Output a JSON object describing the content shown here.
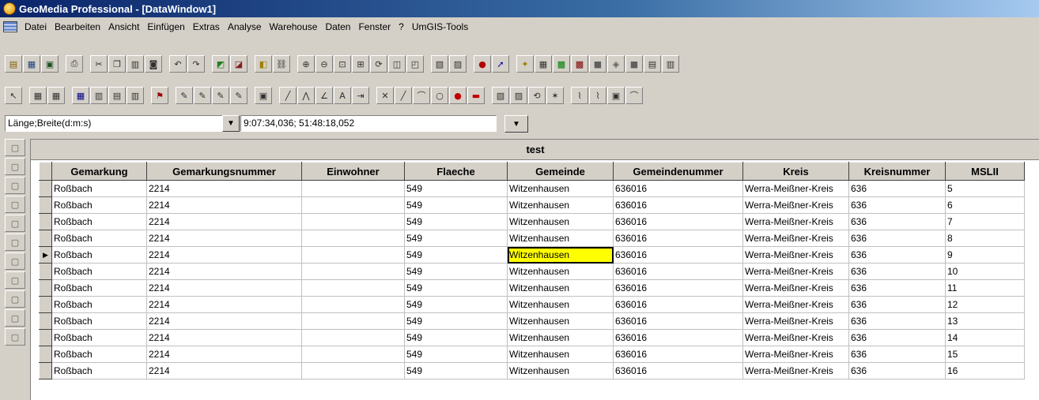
{
  "window": {
    "title": "GeoMedia Professional - [DataWindow1]"
  },
  "menu": [
    "Datei",
    "Bearbeiten",
    "Ansicht",
    "Einfügen",
    "Extras",
    "Analyse",
    "Warehouse",
    "Daten",
    "Fenster",
    "?",
    "UmGIS-Tools"
  ],
  "coords": {
    "system": "Länge;Breite(d:m:s)",
    "value": "9:07:34,036; 51:48:18,052"
  },
  "grid": {
    "caption": "test",
    "columns": [
      "Gemarkung",
      "Gemarkungsnummer",
      "Einwohner",
      "Flaeche",
      "Gemeinde",
      "Gemeindenummer",
      "Kreis",
      "Kreisnummer",
      "MSLII"
    ],
    "rows": [
      [
        "Roßbach",
        "2214",
        "",
        "549",
        "Witzenhausen",
        "636016",
        "Werra-Meißner-Kreis",
        "636",
        "5"
      ],
      [
        "Roßbach",
        "2214",
        "",
        "549",
        "Witzenhausen",
        "636016",
        "Werra-Meißner-Kreis",
        "636",
        "6"
      ],
      [
        "Roßbach",
        "2214",
        "",
        "549",
        "Witzenhausen",
        "636016",
        "Werra-Meißner-Kreis",
        "636",
        "7"
      ],
      [
        "Roßbach",
        "2214",
        "",
        "549",
        "Witzenhausen",
        "636016",
        "Werra-Meißner-Kreis",
        "636",
        "8"
      ],
      [
        "Roßbach",
        "2214",
        "",
        "549",
        "Witzenhausen",
        "636016",
        "Werra-Meißner-Kreis",
        "636",
        "9"
      ],
      [
        "Roßbach",
        "2214",
        "",
        "549",
        "Witzenhausen",
        "636016",
        "Werra-Meißner-Kreis",
        "636",
        "10"
      ],
      [
        "Roßbach",
        "2214",
        "",
        "549",
        "Witzenhausen",
        "636016",
        "Werra-Meißner-Kreis",
        "636",
        "11"
      ],
      [
        "Roßbach",
        "2214",
        "",
        "549",
        "Witzenhausen",
        "636016",
        "Werra-Meißner-Kreis",
        "636",
        "12"
      ],
      [
        "Roßbach",
        "2214",
        "",
        "549",
        "Witzenhausen",
        "636016",
        "Werra-Meißner-Kreis",
        "636",
        "13"
      ],
      [
        "Roßbach",
        "2214",
        "",
        "549",
        "Witzenhausen",
        "636016",
        "Werra-Meißner-Kreis",
        "636",
        "14"
      ],
      [
        "Roßbach",
        "2214",
        "",
        "549",
        "Witzenhausen",
        "636016",
        "Werra-Meißner-Kreis",
        "636",
        "15"
      ],
      [
        "Roßbach",
        "2214",
        "",
        "549",
        "Witzenhausen",
        "636016",
        "Werra-Meißner-Kreis",
        "636",
        "16"
      ]
    ],
    "current_row": 4,
    "current_col": 4,
    "current_row_marker": "▶"
  },
  "colors": {
    "title_bg": "#0a246a",
    "selected_cell": "#ffff00",
    "chrome": "#d4d0c8"
  }
}
